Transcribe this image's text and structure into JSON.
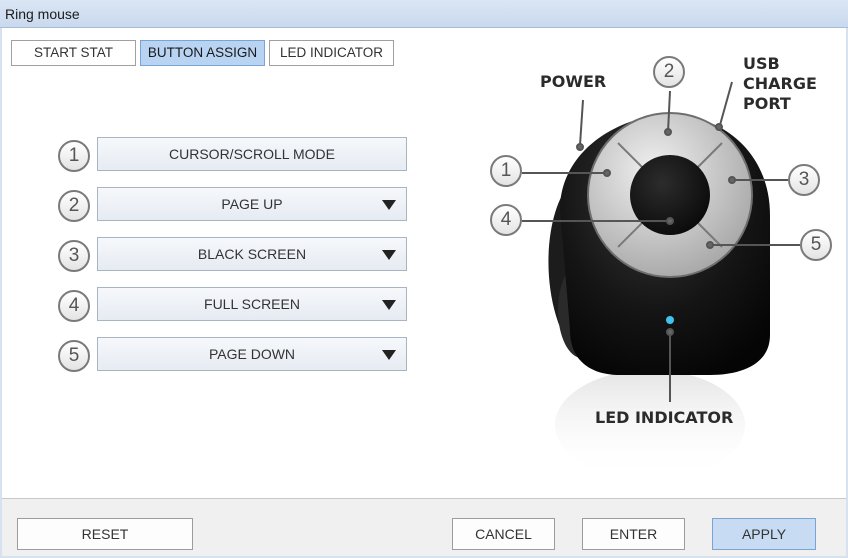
{
  "window": {
    "title": "Ring mouse"
  },
  "tabs": [
    {
      "label": "START STAT",
      "active": false
    },
    {
      "label": "BUTTON ASSIGN",
      "active": true
    },
    {
      "label": "LED INDICATOR",
      "active": false
    }
  ],
  "assignments": [
    {
      "num": "1",
      "label": "CURSOR/SCROLL MODE",
      "dropdown": false
    },
    {
      "num": "2",
      "label": "PAGE UP",
      "dropdown": true
    },
    {
      "num": "3",
      "label": "BLACK SCREEN",
      "dropdown": true
    },
    {
      "num": "4",
      "label": "FULL SCREEN",
      "dropdown": true
    },
    {
      "num": "5",
      "label": "PAGE DOWN",
      "dropdown": true
    }
  ],
  "device": {
    "power_label": "POWER",
    "usb_label": {
      "line1": "USB",
      "line2": "CHARGE",
      "line3": "PORT"
    },
    "led_label": "LED INDICATOR",
    "callouts": [
      "1",
      "2",
      "3",
      "4",
      "5"
    ]
  },
  "footer": {
    "reset": "RESET",
    "cancel": "CANCEL",
    "enter": "ENTER",
    "apply": "APPLY"
  },
  "colors": {
    "accent": "#b9d3f2",
    "led": "#3fc4f0"
  }
}
